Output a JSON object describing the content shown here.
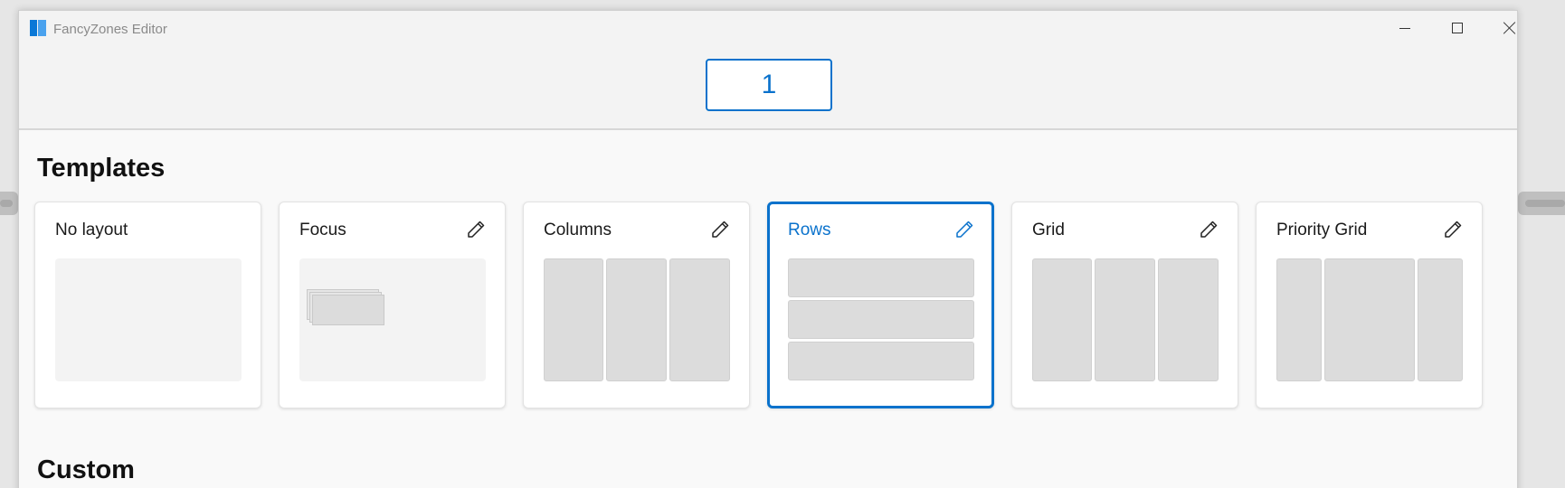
{
  "window": {
    "title": "FancyZones Editor"
  },
  "header": {
    "monitor_label": "1"
  },
  "sections": {
    "templates_title": "Templates",
    "custom_title": "Custom"
  },
  "templates": [
    {
      "label": "No layout",
      "editable": false,
      "selected": false
    },
    {
      "label": "Focus",
      "editable": true,
      "selected": false
    },
    {
      "label": "Columns",
      "editable": true,
      "selected": false
    },
    {
      "label": "Rows",
      "editable": true,
      "selected": true
    },
    {
      "label": "Grid",
      "editable": true,
      "selected": false
    },
    {
      "label": "Priority Grid",
      "editable": true,
      "selected": false
    }
  ],
  "icons": {
    "app": "fancyzones-icon",
    "edit": "pencil-icon",
    "minimize": "minimize-icon",
    "maximize": "maximize-icon",
    "close": "close-icon"
  },
  "colors": {
    "accent": "#0a72cc",
    "zone": "#dcdcdc",
    "background": "#f9f9f9"
  }
}
